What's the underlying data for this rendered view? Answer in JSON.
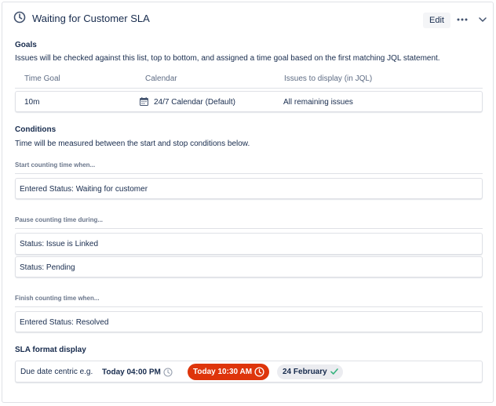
{
  "header": {
    "title": "Waiting for Customer SLA",
    "edit_label": "Edit",
    "icon": "clock-icon",
    "more_icon": "more-icon",
    "collapse_icon": "chevron-down-icon"
  },
  "goals": {
    "title": "Goals",
    "description": "Issues will be checked against this list, top to bottom, and assigned a time goal based on the first matching JQL statement.",
    "columns": [
      "Time Goal",
      "Calendar",
      "Issues to display (in JQL)"
    ],
    "rows": [
      {
        "time_goal": "10m",
        "calendar": "24/7 Calendar (Default)",
        "issues": "All remaining issues"
      }
    ]
  },
  "conditions": {
    "title": "Conditions",
    "description": "Time will be measured between the start and stop conditions below.",
    "start": {
      "label": "Start counting time when...",
      "items": [
        "Entered Status: Waiting for customer"
      ]
    },
    "pause": {
      "label": "Pause counting time during...",
      "items": [
        "Status: Issue is Linked",
        "Status: Pending"
      ]
    },
    "finish": {
      "label": "Finish counting time when...",
      "items": [
        "Entered Status: Resolved"
      ]
    }
  },
  "sla_format": {
    "title": "SLA format display",
    "label": "Due date centric e.g.",
    "example_1": "Today 04:00 PM",
    "example_2": "Today 10:30 AM",
    "example_3": "24 February"
  },
  "colors": {
    "accent_red": "#de350b",
    "success_green": "#36b37e",
    "text": "#172b4d",
    "subtle": "#6b778c"
  }
}
